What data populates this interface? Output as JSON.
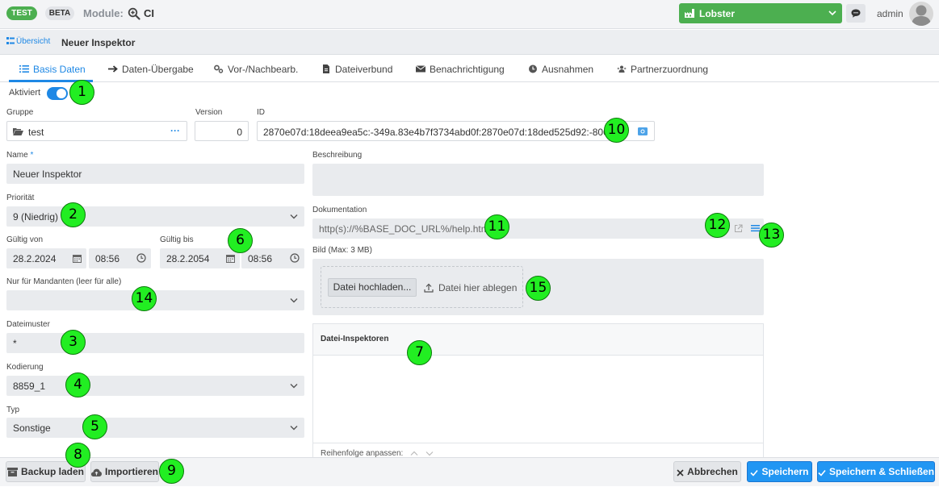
{
  "topbar": {
    "tag_test": "TEST",
    "tag_beta": "BETA",
    "module_label": "Module:",
    "module_value": "CI",
    "tenant": "Lobster",
    "user": "admin"
  },
  "breadcrumb": {
    "link": "Übersicht",
    "title": "Neuer Inspektor"
  },
  "tabs": [
    {
      "label": "Basis Daten",
      "icon": "list-icon",
      "active": true
    },
    {
      "label": "Daten-Übergabe",
      "icon": "arrow-right-icon"
    },
    {
      "label": "Vor-/Nachbearb.",
      "icon": "gears-icon"
    },
    {
      "label": "Dateiverbund",
      "icon": "file-icon"
    },
    {
      "label": "Benachrichtigung",
      "icon": "envelope-icon"
    },
    {
      "label": "Ausnahmen",
      "icon": "clock-icon"
    },
    {
      "label": "Partnerzuordnung",
      "icon": "partner-icon"
    }
  ],
  "form": {
    "activated_label": "Aktiviert",
    "activated": true,
    "group_label": "Gruppe",
    "group_value": "test",
    "group_more": "···",
    "version_label": "Version",
    "version_value": "0",
    "id_label": "ID",
    "id_value": "2870e07d:18deea9ea5c:-349a.83e4b7f3734abd0f:2870e07d:18ded525d92:-8000",
    "name_label": "Name",
    "name_required": "*",
    "name_value": "Neuer Inspektor",
    "priority_label": "Priorität",
    "priority_value": "9 (Niedrig)",
    "valid_from_label": "Gültig von",
    "valid_from_date": "28.2.2024",
    "valid_from_time": "08:56",
    "valid_to_label": "Gültig bis",
    "valid_to_date": "28.2.2054",
    "valid_to_time": "08:56",
    "clients_label": "Nur für Mandanten (leer für alle)",
    "clients_value": "",
    "file_pattern_label": "Dateimuster",
    "file_pattern_value": "*",
    "encoding_label": "Kodierung",
    "encoding_value": "8859_1",
    "type_label": "Typ",
    "type_value": "Sonstige",
    "description_label": "Beschreibung",
    "description_value": "",
    "documentation_label": "Dokumentation",
    "documentation_value": "http(s)://%BASE_DOC_URL%/help.html",
    "image_label": "Bild (Max: 3 MB)",
    "upload_button": "Datei hochladen...",
    "drop_label": "Datei hier ablegen",
    "inspectors_title": "Datei-Inspektoren",
    "reorder_label": "Reihenfolge anpassen:"
  },
  "footer": {
    "backup": "Backup laden",
    "import": "Importieren",
    "cancel": "Abbrechen",
    "save": "Speichern",
    "save_close": "Speichern & Schließen"
  },
  "markers": [
    "1",
    "2",
    "3",
    "4",
    "5",
    "6",
    "7",
    "8",
    "9",
    "10",
    "11",
    "12",
    "13",
    "14",
    "15"
  ],
  "colors": {
    "accent": "#1e88e5",
    "tenant": "#4caf50",
    "marker": "#22ee22"
  }
}
